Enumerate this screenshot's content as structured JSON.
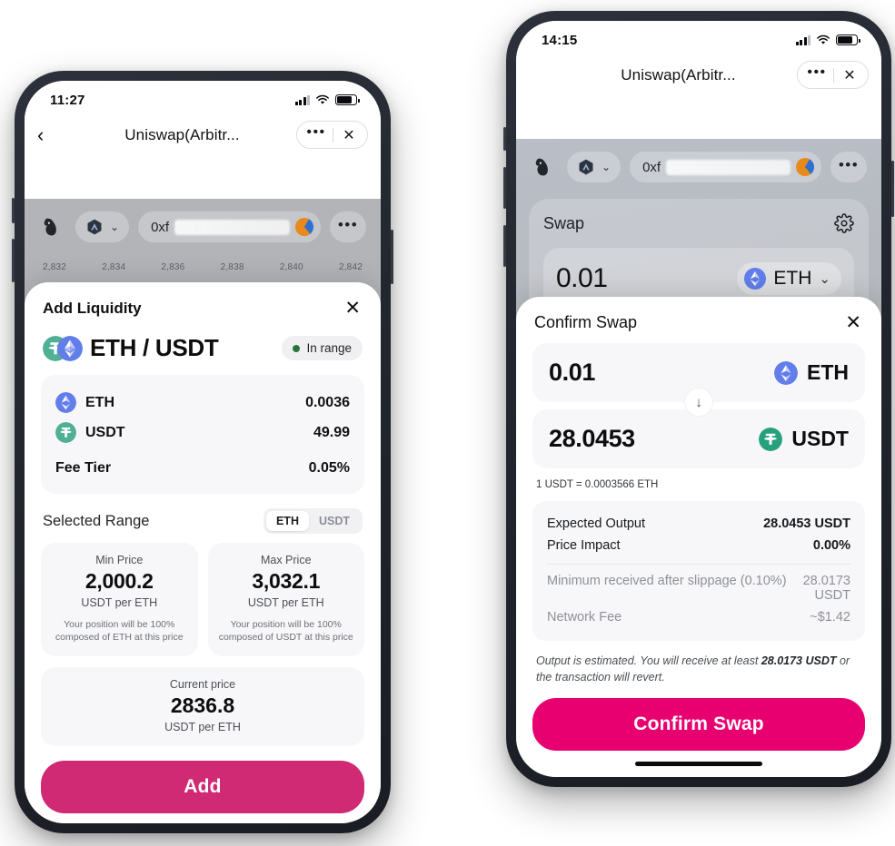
{
  "left_phone": {
    "status": {
      "time": "11:27",
      "signal_icon": "cellular-signal-icon",
      "wifi_icon": "wifi-icon",
      "battery_icon": "battery-icon"
    },
    "nav": {
      "back_icon": "chevron-left-icon",
      "title": "Uniswap(Arbitr...",
      "more_label": "•••",
      "close_label": "✕"
    },
    "dapp": {
      "logo_icon": "uniswap-unicorn-logo",
      "chain_icon": "arbitrum-icon",
      "chain_chevron": "chevron-down-icon",
      "address": "0xf",
      "avatar_icon": "wallet-avatar-icon",
      "more_label": "•••",
      "chart_axis": [
        "2,832",
        "2,834",
        "2,836",
        "2,838",
        "2,840",
        "2,842"
      ]
    },
    "sheet": {
      "title": "Add Liquidity",
      "close_icon": "close-icon",
      "pair_name": "ETH / USDT",
      "status_badge": "In range",
      "status_color": "#27753d",
      "tokens": [
        {
          "icon": "eth-icon",
          "symbol": "ETH",
          "amount": "0.0036",
          "color": "#627EEA"
        },
        {
          "icon": "usdt-icon",
          "symbol": "USDT",
          "amount": "49.99",
          "color": "#50AF95"
        }
      ],
      "fee_tier_label": "Fee Tier",
      "fee_tier_value": "0.05%",
      "range_section_title": "Selected Range",
      "toggle": {
        "options": [
          "ETH",
          "USDT"
        ],
        "selected": "ETH"
      },
      "min_price": {
        "label": "Min Price",
        "value": "2,000.2",
        "unit": "USDT per ETH",
        "note": "Your position will be 100% composed of ETH at this price"
      },
      "max_price": {
        "label": "Max Price",
        "value": "3,032.1",
        "unit": "USDT per ETH",
        "note": "Your position will be 100% composed of USDT at this price"
      },
      "current_price": {
        "label": "Current price",
        "value": "2836.8",
        "unit": "USDT per ETH"
      },
      "cta_label": "Add",
      "cta_color": "#d02a74"
    }
  },
  "right_phone": {
    "status": {
      "time": "14:15",
      "signal_icon": "cellular-signal-icon",
      "wifi_icon": "wifi-icon",
      "battery_icon": "battery-icon"
    },
    "nav": {
      "title": "Uniswap(Arbitr...",
      "more_label": "•••",
      "close_label": "✕"
    },
    "dapp": {
      "logo_icon": "uniswap-unicorn-logo",
      "chain_icon": "arbitrum-icon",
      "chain_chevron": "chevron-down-icon",
      "address": "0xf",
      "avatar_icon": "wallet-avatar-icon",
      "more_label": "•••",
      "swap_card_title": "Swap",
      "settings_icon": "gear-icon",
      "input_amount": "0.01",
      "input_token": "ETH",
      "input_token_chevron": "chevron-down-icon"
    },
    "sheet": {
      "title": "Confirm Swap",
      "close_icon": "close-icon",
      "from": {
        "amount": "0.01",
        "symbol": "ETH",
        "icon": "eth-icon",
        "color": "#627EEA"
      },
      "arrow_icon": "arrow-down-icon",
      "to": {
        "amount": "28.0453",
        "symbol": "USDT",
        "icon": "usdt-icon",
        "color": "#26A17B"
      },
      "rate": "1 USDT = 0.0003566 ETH",
      "details": [
        {
          "label": "Expected Output",
          "value": "28.0453 USDT",
          "muted": false
        },
        {
          "label": "Price Impact",
          "value": "0.00%",
          "muted": false
        },
        {
          "label": "Minimum received after slippage (0.10%)",
          "value": "28.0173\nUSDT",
          "muted": true
        },
        {
          "label": "Network Fee",
          "value": "~$1.42",
          "muted": true
        }
      ],
      "disclaimer_pre": "Output is estimated. You will receive at least ",
      "disclaimer_bold": "28.0173 USDT",
      "disclaimer_post": " or the transaction will revert.",
      "cta_label": "Confirm Swap",
      "cta_color": "#e80071"
    }
  }
}
